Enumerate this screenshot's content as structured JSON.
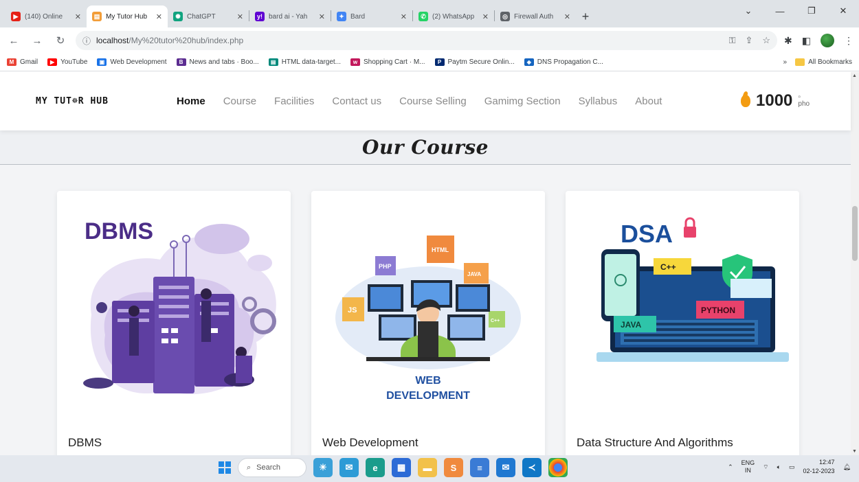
{
  "browser": {
    "tabs": [
      {
        "label": "(140) Online",
        "icon": "youtube-icon",
        "color": "#e62117",
        "active": false
      },
      {
        "label": "My Tutor Hub",
        "icon": "page-icon",
        "color": "#f29d38",
        "active": true
      },
      {
        "label": "ChatGPT",
        "icon": "chatgpt-icon",
        "color": "#10a37f",
        "active": false
      },
      {
        "label": "bard ai - Yah",
        "icon": "yahoo-icon",
        "color": "#6001d2",
        "active": false
      },
      {
        "label": "Bard",
        "icon": "bard-icon",
        "color": "#4285f4",
        "active": false
      },
      {
        "label": "(2) WhatsApp",
        "icon": "whatsapp-icon",
        "color": "#25d366",
        "active": false
      },
      {
        "label": "Firewall Auth",
        "icon": "globe-icon",
        "color": "#5f6368",
        "active": false
      }
    ],
    "url_host": "localhost",
    "url_path": "/My%20tutor%20hub/index.php",
    "bookmarks": [
      {
        "label": "Gmail",
        "color": "#ea4335"
      },
      {
        "label": "YouTube",
        "color": "#ff0000"
      },
      {
        "label": "Web Development",
        "color": "#1a73e8"
      },
      {
        "label": "News and tabs · Boo...",
        "color": "#5c2d91"
      },
      {
        "label": "HTML data-target...",
        "color": "#00897b"
      },
      {
        "label": "Shopping Cart · M...",
        "color": "#c2185b"
      },
      {
        "label": "Paytm Secure Onlin...",
        "color": "#002970"
      },
      {
        "label": "DNS Propagation C...",
        "color": "#1565c0"
      }
    ],
    "all_bookmarks": "All Bookmarks"
  },
  "site": {
    "logo": "MY TUT☸R HUB",
    "menu": [
      "Home",
      "Course",
      "Facilities",
      "Contact us",
      "Course Selling",
      "Gamimg Section",
      "Syllabus",
      "About"
    ],
    "active_menu": "Home",
    "coins": "1000",
    "avatar_alt": "pho",
    "section_title": "Our Course",
    "courses": [
      {
        "title": "DBMS",
        "art_text": "DBMS"
      },
      {
        "title": "Web Development",
        "art_text_1": "WEB",
        "art_text_2": "DEVELOPMENT",
        "labels": [
          "PHP",
          "HTML",
          "JAVA",
          "JS",
          "C++"
        ]
      },
      {
        "title": "Data Structure And Algorithms",
        "art_text": "DSA",
        "labels": [
          "C++",
          "PYTHON",
          "JAVA"
        ]
      }
    ]
  },
  "taskbar": {
    "search_placeholder": "Search",
    "lang_1": "ENG",
    "lang_2": "IN",
    "time": "12:47",
    "date": "02-12-2023"
  }
}
